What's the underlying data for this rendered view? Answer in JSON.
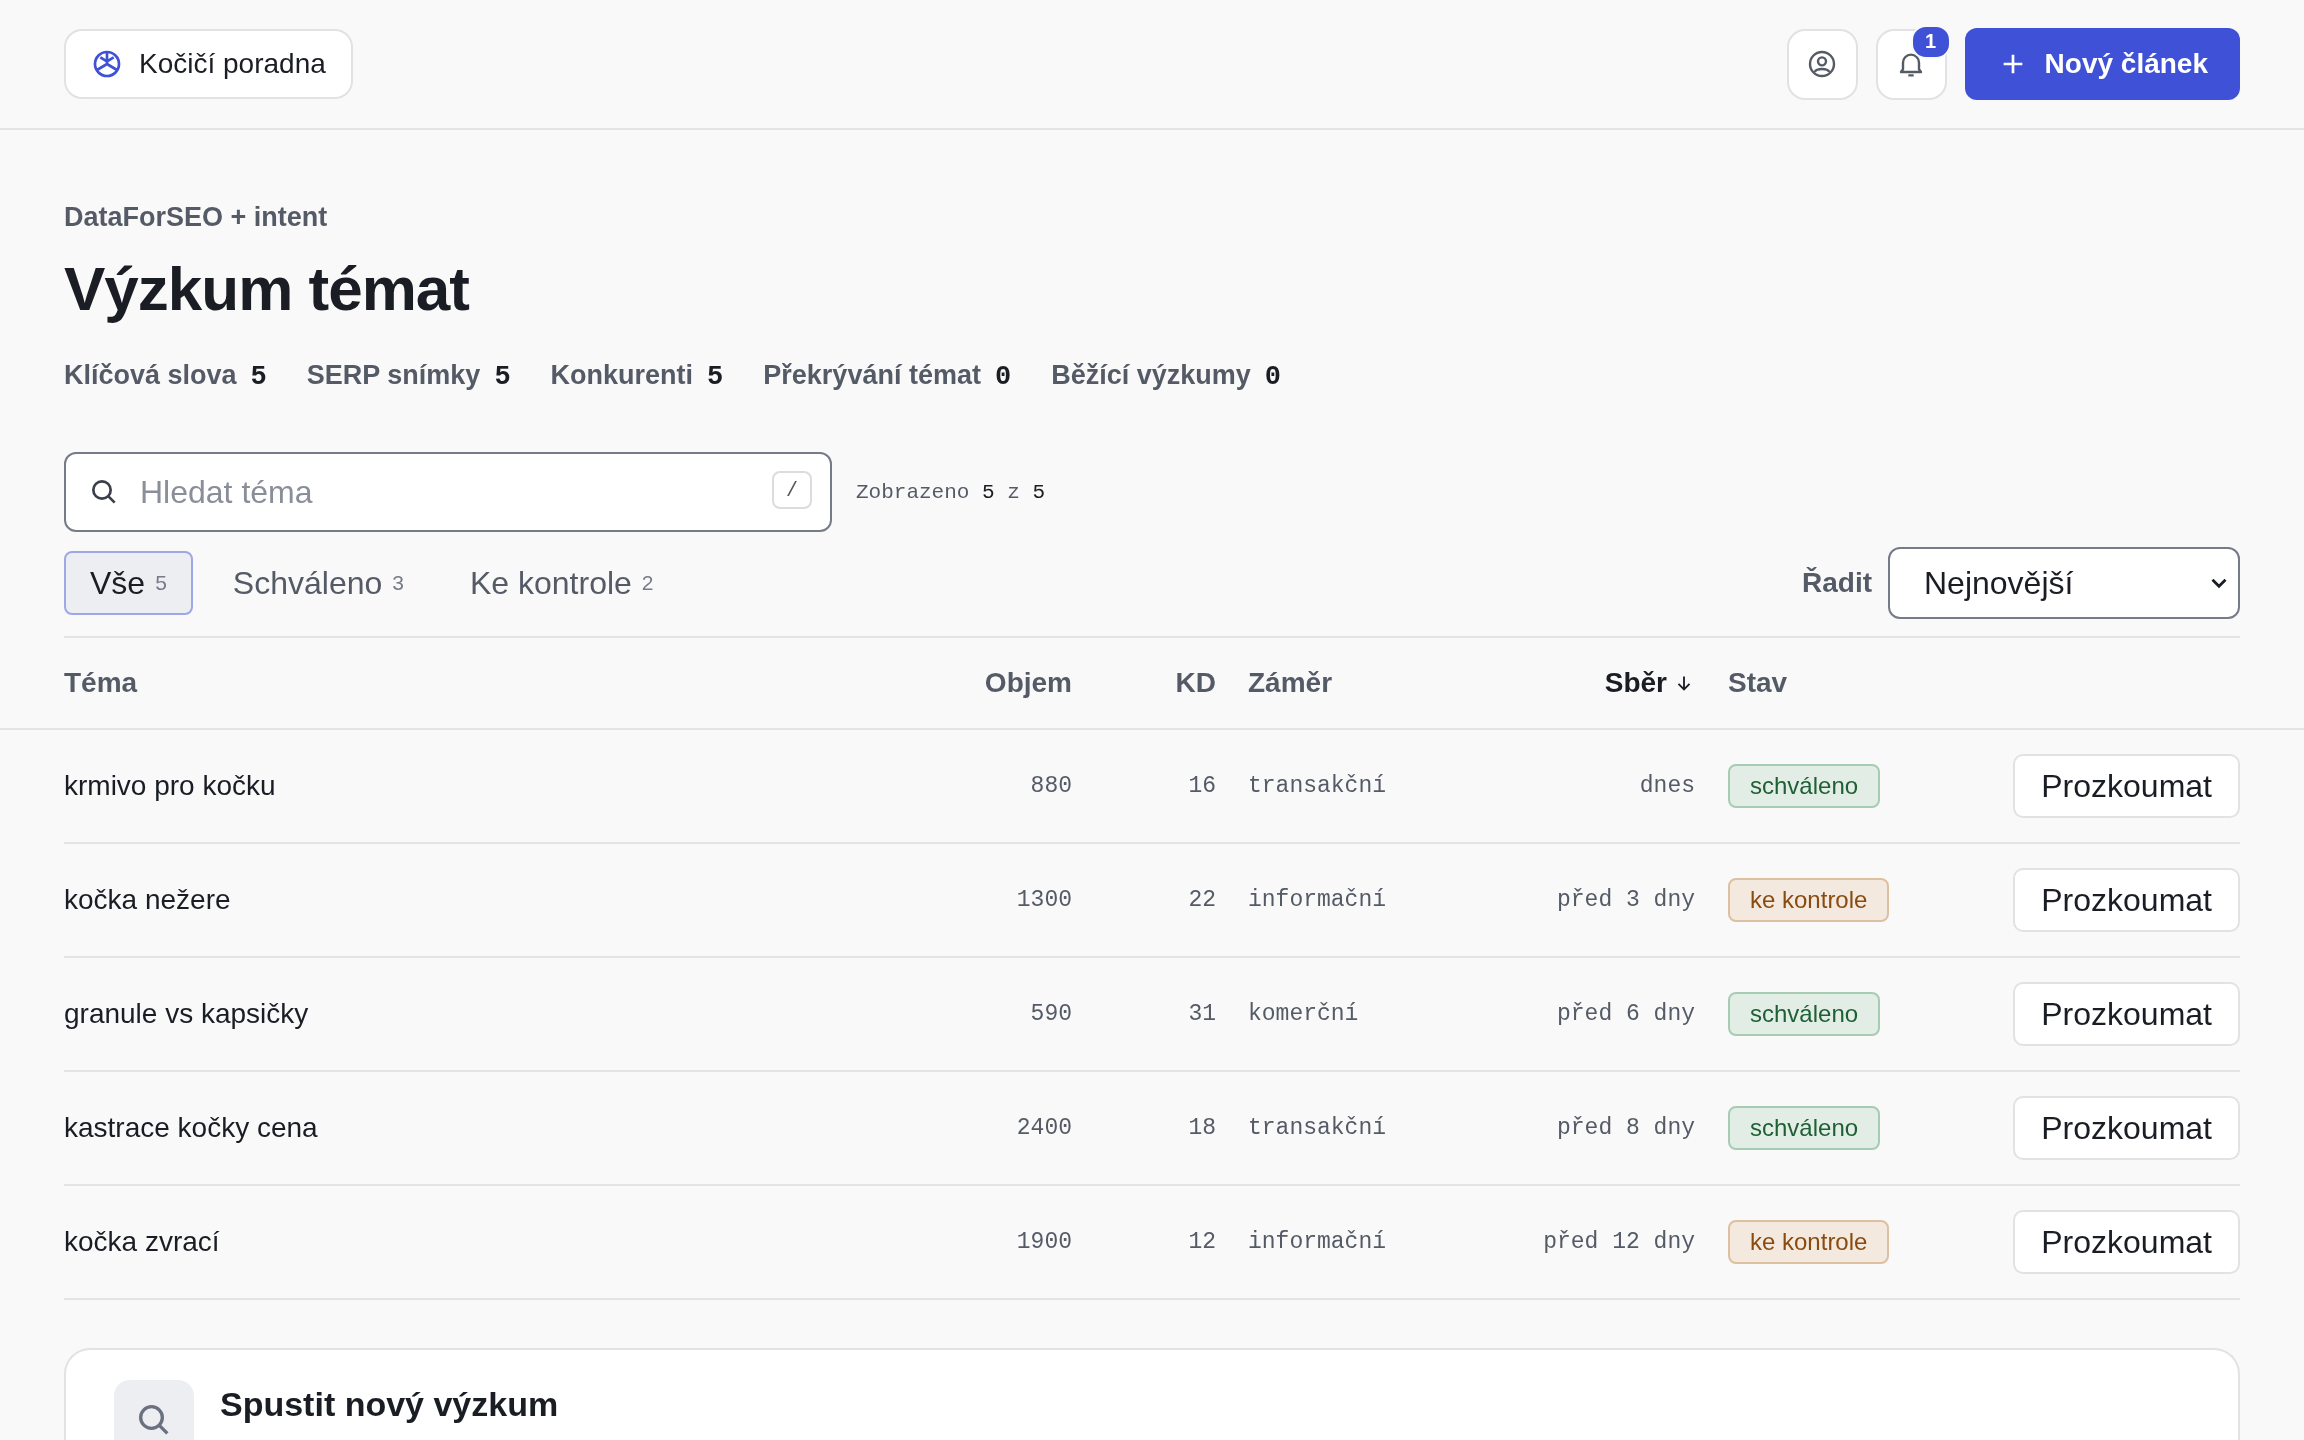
{
  "header": {
    "brand": "Kočičí poradna",
    "notifications": "1",
    "new_button": "Nový článek"
  },
  "breadcrumb": "DataForSEO + intent",
  "title": "Výzkum témat",
  "stats": [
    {
      "label": "Klíčová slova",
      "value": "5"
    },
    {
      "label": "SERP snímky",
      "value": "5"
    },
    {
      "label": "Konkurenti",
      "value": "5"
    },
    {
      "label": "Překrývání témat",
      "value": "0"
    },
    {
      "label": "Běžící výzkumy",
      "value": "0"
    }
  ],
  "search": {
    "placeholder": "Hledat téma",
    "shortcut": "/"
  },
  "shown": {
    "label": "Zobrazeno",
    "count": "5",
    "sep": "z",
    "total": "5"
  },
  "tabs": [
    {
      "label": "Vše",
      "count": "5",
      "selected": true
    },
    {
      "label": "Schváleno",
      "count": "3",
      "selected": false
    },
    {
      "label": "Ke kontrole",
      "count": "2",
      "selected": false
    }
  ],
  "sort": {
    "label": "Řadit",
    "value": "Nejnovější"
  },
  "table": {
    "columns": [
      {
        "label": "Téma",
        "sorted": false
      },
      {
        "label": "Objem",
        "sorted": false
      },
      {
        "label": "KD",
        "sorted": false
      },
      {
        "label": "Záměr",
        "sorted": false
      },
      {
        "label": "Sběr",
        "sorted": true
      },
      {
        "label": "Stav",
        "sorted": false
      }
    ],
    "rows": [
      {
        "topic": "krmivo pro kočku",
        "volume": "880",
        "kd": "16",
        "intent": "transakční",
        "collected": "dnes",
        "status": {
          "kind": "approved",
          "label": "schváleno"
        },
        "action": "Prozkoumat"
      },
      {
        "topic": "kočka nežere",
        "volume": "1300",
        "kd": "22",
        "intent": "informační",
        "collected": "před 3 dny",
        "status": {
          "kind": "review",
          "label": "ke kontrole"
        },
        "action": "Prozkoumat"
      },
      {
        "topic": "granule vs kapsičky",
        "volume": "590",
        "kd": "31",
        "intent": "komerční",
        "collected": "před 6 dny",
        "status": {
          "kind": "approved",
          "label": "schváleno"
        },
        "action": "Prozkoumat"
      },
      {
        "topic": "kastrace kočky cena",
        "volume": "2400",
        "kd": "18",
        "intent": "transakční",
        "collected": "před 8 dny",
        "status": {
          "kind": "approved",
          "label": "schváleno"
        },
        "action": "Prozkoumat"
      },
      {
        "topic": "kočka zvrací",
        "volume": "1900",
        "kd": "12",
        "intent": "informační",
        "collected": "před 12 dny",
        "status": {
          "kind": "review",
          "label": "ke kontrole"
        },
        "action": "Prozkoumat"
      }
    ]
  },
  "new_research": {
    "title": "Spustit nový výzkum"
  }
}
